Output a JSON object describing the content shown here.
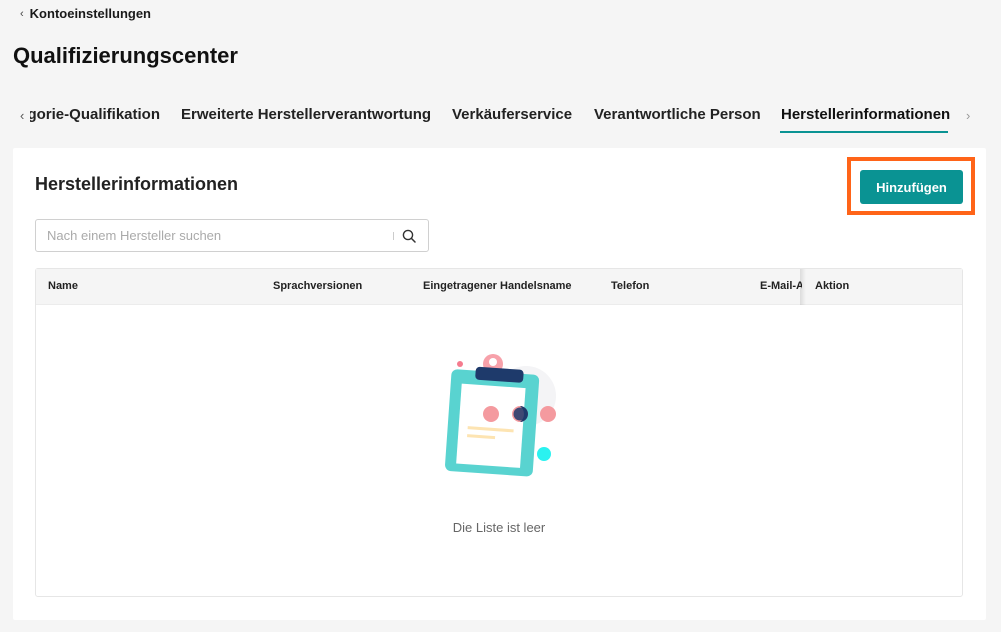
{
  "breadcrumb": {
    "back_label": "Kontoeinstellungen"
  },
  "page": {
    "title": "Qualifizierungscenter"
  },
  "tabs": [
    {
      "label": "Kategorie-Qualifikation",
      "active": false
    },
    {
      "label": "Erweiterte Herstellerverantwortung",
      "active": false
    },
    {
      "label": "Verkäuferservice",
      "active": false
    },
    {
      "label": "Verantwortliche Person",
      "active": false
    },
    {
      "label": "Herstellerinformationen",
      "active": true
    }
  ],
  "section": {
    "title": "Herstellerinformationen",
    "add_button": "Hinzufügen"
  },
  "search": {
    "placeholder": "Nach einem Hersteller suchen",
    "value": ""
  },
  "table": {
    "columns": [
      "Name",
      "Sprachversionen",
      "Eingetragener Handelsname",
      "Telefon",
      "E-Mail-Adresse",
      "Aktion"
    ],
    "rows": [],
    "empty_text": "Die Liste ist leer"
  },
  "colors": {
    "accent": "#0a9393",
    "highlight": "#ff6418"
  }
}
